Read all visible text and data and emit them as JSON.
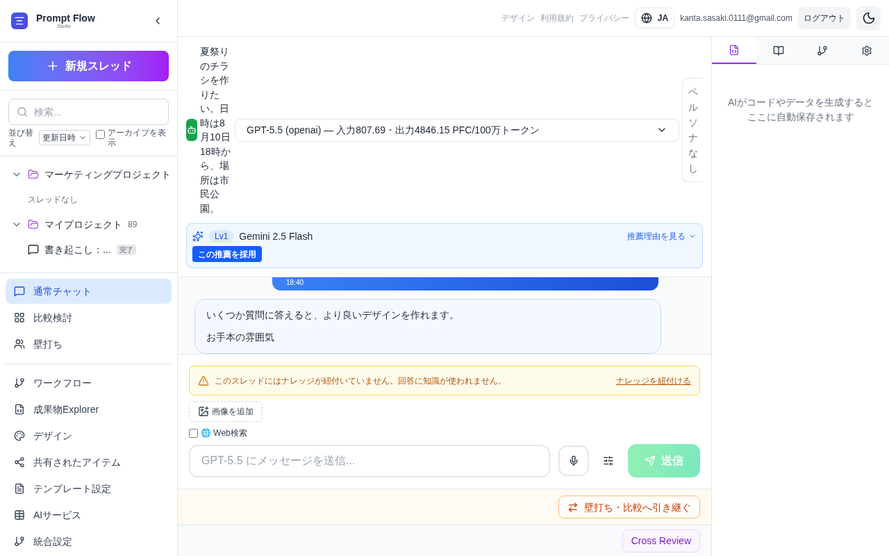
{
  "app": {
    "name": "Prompt Flow",
    "subtitle": "Studio"
  },
  "sidebar": {
    "new_button": "新規スレッド",
    "search": {
      "placeholder": "検索..."
    },
    "sort_label": "並び替え",
    "sort_value": "更新日時",
    "archive": {
      "label": "アーカイブを表示",
      "checked": false
    },
    "projects": [
      {
        "name": "マーケティングプロジェクト",
        "expanded": true,
        "empty": "スレッドなし"
      },
      {
        "name": "マイプロジェクト",
        "count": "89",
        "expanded": true,
        "threads": [
          {
            "title": "書き起こし：...",
            "badge": "完了"
          }
        ]
      }
    ],
    "modes": [
      {
        "label": "通常チャット",
        "selected": true
      },
      {
        "label": "比較検討",
        "selected": false
      },
      {
        "label": "壁打ち",
        "selected": false
      }
    ],
    "nav": [
      "ワークフロー",
      "成果物Explorer",
      "デザイン",
      "共有されたアイテム",
      "テンプレート設定",
      "AIサービス",
      "統合設定"
    ]
  },
  "header": {
    "links": [
      "デザイン",
      "利用規約",
      "プライバシー"
    ],
    "language": "JA",
    "email": "kanta.sasaki.0111@gmail.com",
    "logout": "ログアウト"
  },
  "model_bar": {
    "prompt": "夏祭りのチラシを作りたい。日時は8月10日18時から、場所は市民公園。",
    "model": "GPT-5.5 (openai) — 入力807.69・出力4846.15 PFC/100万トークン",
    "persona": "ペルソナなし"
  },
  "recommendation": {
    "level": "Lv1",
    "model": "Gemini 2.5 Flash",
    "reason_link": "推薦理由を見る",
    "adopt": "この推薦を採用"
  },
  "messages": [
    {
      "kind": "user",
      "time": "18:40"
    },
    {
      "kind": "assistant",
      "lines": [
        "いくつか質問に答えると、より良いデザインを作れます。",
        "お手本の雰囲気"
      ]
    }
  ],
  "warning": {
    "text": "このスレッドにはナレッジが紐付いていません。回答に知識が使われません。",
    "link": "ナレッジを紐付ける"
  },
  "composer": {
    "add_image": "画像を追加",
    "web_search": {
      "label": "🌐 Web検索",
      "checked": false
    },
    "placeholder": "GPT-5.5 にメッセージを送信...",
    "send": "送信",
    "send_disabled": true
  },
  "handoff": "壁打ち・比較へ引き継ぐ",
  "cross_review": "Cross Review",
  "right_panel": {
    "tabs": [
      {
        "selected": true
      },
      {
        "selected": false
      },
      {
        "selected": false
      },
      {
        "selected": false
      }
    ],
    "empty": "AIがコードやデータを生成するとここに自動保存されます"
  }
}
